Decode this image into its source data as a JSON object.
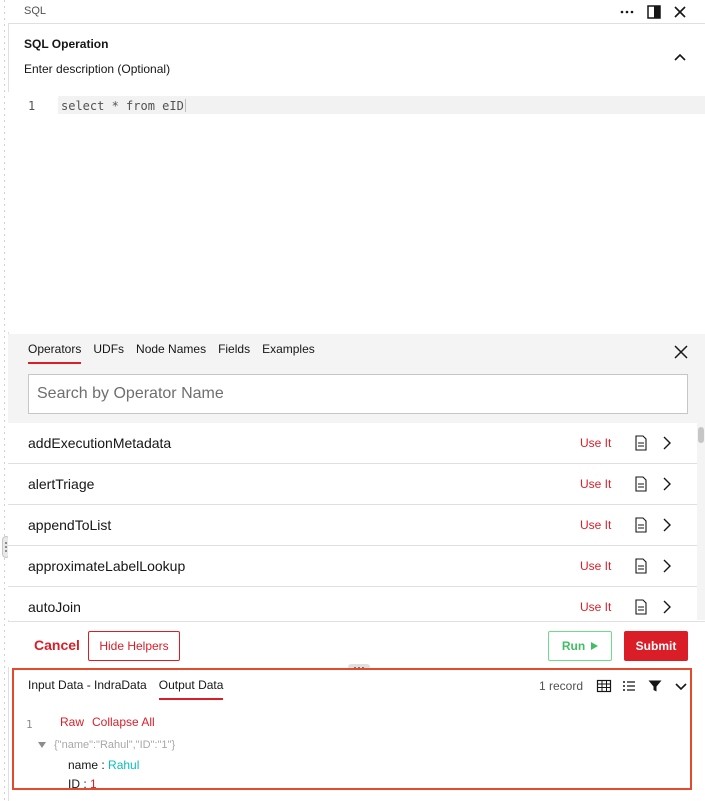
{
  "window": {
    "title": "SQL"
  },
  "operation": {
    "title": "SQL Operation",
    "description_placeholder": "Enter description (Optional)"
  },
  "editor": {
    "line_number": "1",
    "code": "select * from eID"
  },
  "helpers": {
    "tabs": [
      {
        "label": "Operators",
        "active": true
      },
      {
        "label": "UDFs",
        "active": false
      },
      {
        "label": "Node Names",
        "active": false
      },
      {
        "label": "Fields",
        "active": false
      },
      {
        "label": "Examples",
        "active": false
      }
    ],
    "search_placeholder": "Search by Operator Name",
    "use_label": "Use It",
    "operators": [
      "addExecutionMetadata",
      "alertTriage",
      "appendToList",
      "approximateLabelLookup",
      "autoJoin"
    ]
  },
  "actions": {
    "cancel": "Cancel",
    "hide_helpers": "Hide Helpers",
    "run": "Run",
    "submit": "Submit"
  },
  "output": {
    "tabs": [
      {
        "label": "Input Data - IndraData",
        "active": false
      },
      {
        "label": "Output Data",
        "active": true
      }
    ],
    "record_count": "1 record",
    "line_number": "1",
    "raw_label": "Raw",
    "collapse_all_label": "Collapse All",
    "json_summary": "{\"name\":\"Rahul\",\"ID\":\"1\"}",
    "fields": [
      {
        "key": "name",
        "value": "Rahul",
        "type": "string"
      },
      {
        "key": "ID",
        "value": "1",
        "type": "number"
      }
    ]
  },
  "colors": {
    "accent": "#da1e28",
    "run_green": "#42be65",
    "highlight_border": "#e34b2f",
    "string_value": "#08bdba"
  }
}
